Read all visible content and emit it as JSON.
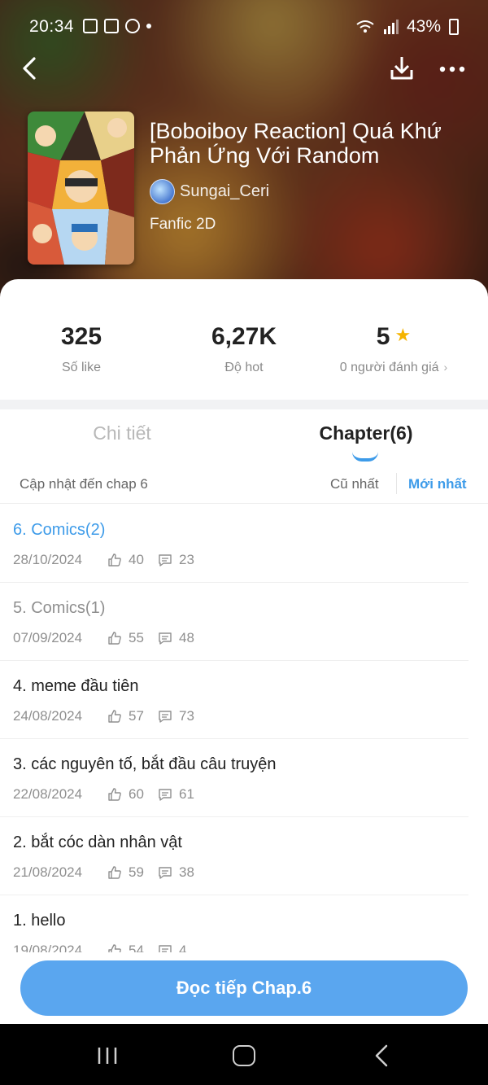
{
  "status_bar": {
    "time": "20:34",
    "battery": "43%"
  },
  "header": {
    "back_icon": "chevron-left-icon",
    "download_icon": "download-icon",
    "more_icon": "more-horizontal-icon",
    "title": "[Boboiboy Reaction] Quá Khứ Phản Ứng Với Random",
    "author": "Sungai_Ceri",
    "genre": "Fanfic 2D"
  },
  "stats": {
    "likes_value": "325",
    "likes_label": "Số like",
    "hot_value": "6,27K",
    "hot_label": "Độ hot",
    "rating_value": "5",
    "rating_label": "0 người đánh giá"
  },
  "tabs": {
    "detail": "Chi tiết",
    "chapter": "Chapter(6)"
  },
  "list_header": {
    "update_text": "Cập nhật đến chap 6",
    "sort_old": "Cũ nhất",
    "sort_new": "Mới nhất"
  },
  "chapters": [
    {
      "title": "6. Comics(2)",
      "date": "28/10/2024",
      "likes": "40",
      "comments": "23"
    },
    {
      "title": "5. Comics(1)",
      "date": "07/09/2024",
      "likes": "55",
      "comments": "48"
    },
    {
      "title": "4. meme đầu tiên",
      "date": "24/08/2024",
      "likes": "57",
      "comments": "73"
    },
    {
      "title": "3. các nguyên tố, bắt đầu câu truyện",
      "date": "22/08/2024",
      "likes": "60",
      "comments": "61"
    },
    {
      "title": "2. bắt cóc dàn nhân vật",
      "date": "21/08/2024",
      "likes": "59",
      "comments": "38"
    },
    {
      "title": "1. hello",
      "date": "19/08/2024",
      "likes": "54",
      "comments": "4"
    }
  ],
  "read_button": "Đọc tiếp Chap.6",
  "colors": {
    "accent": "#3d9be9",
    "button": "#5aa6ef",
    "star": "#f5b400"
  }
}
